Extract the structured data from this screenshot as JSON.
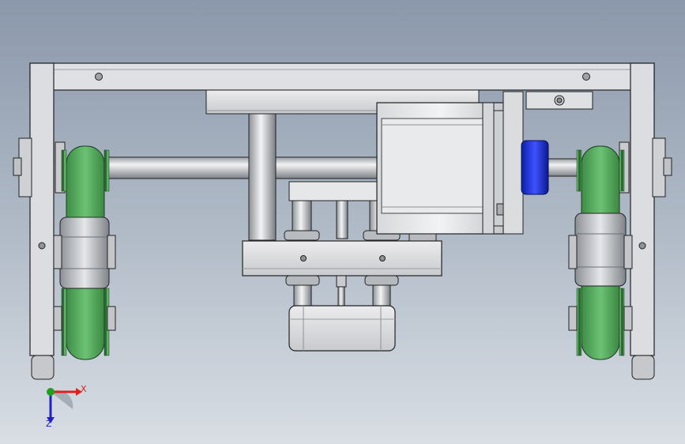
{
  "view": {
    "background_top": "#8b98ab",
    "background_bottom": "#d9dee4"
  },
  "colors": {
    "frame": "#dcdde0",
    "frame_shade": "#a9acb2",
    "belt": "#62b86a",
    "belt_dark": "#2f7a3a",
    "gear_teeth": "#1f4d2a",
    "coupling": "#1c2fd6",
    "edge": "#202020"
  },
  "triad": {
    "x_label": "X",
    "z_label": "Z",
    "x_color": "#e02020",
    "y_color": "#1fa01f",
    "z_color": "#2020c8"
  }
}
